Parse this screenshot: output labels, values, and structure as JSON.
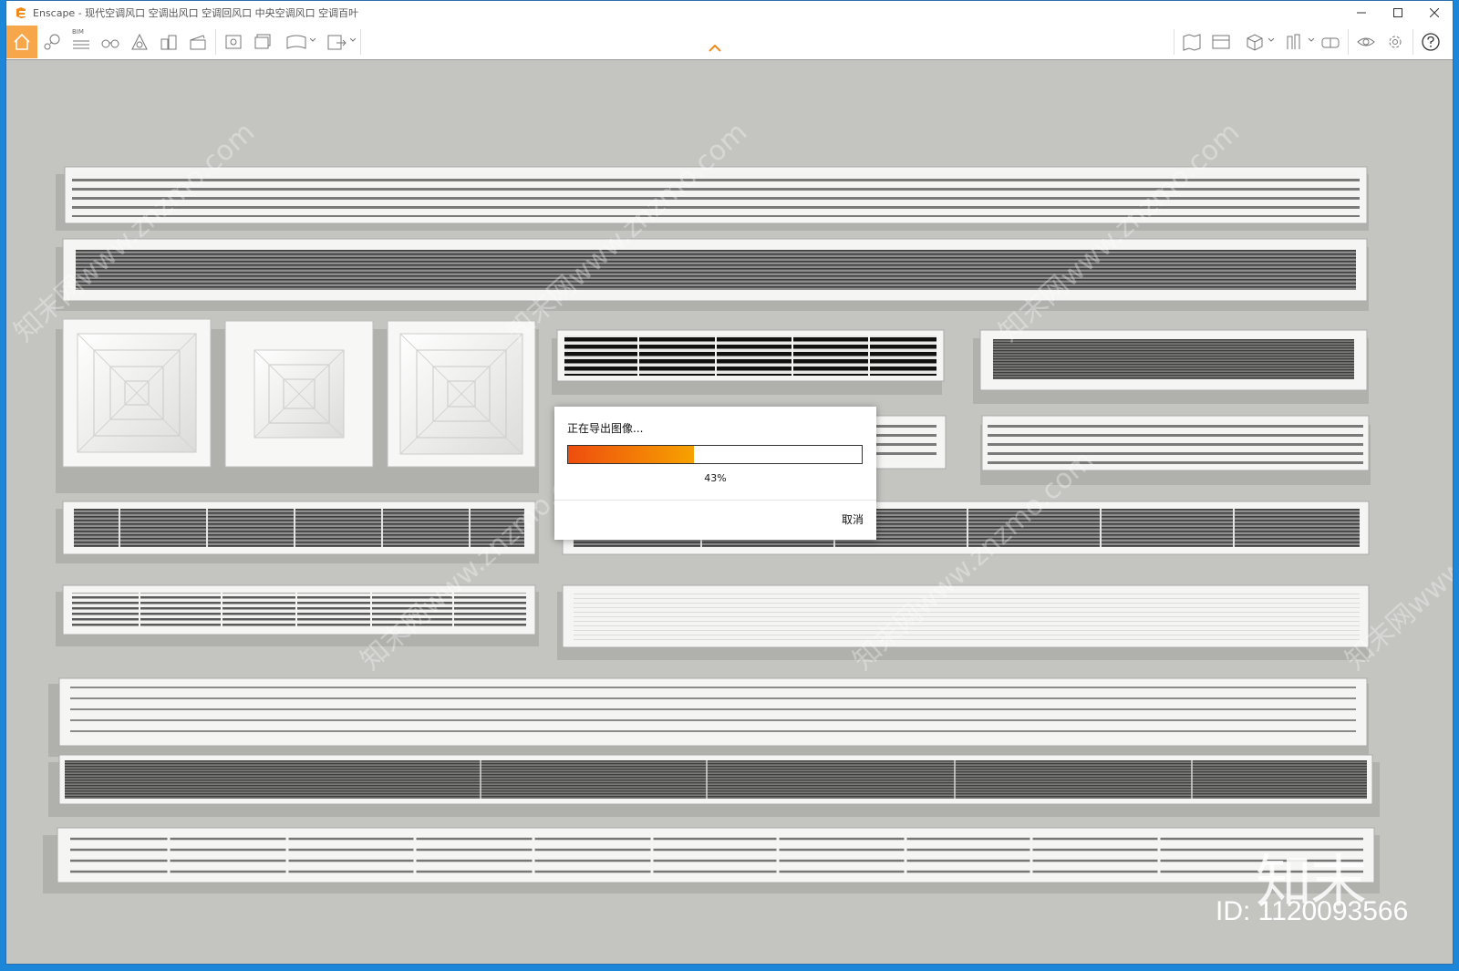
{
  "window": {
    "app_name": "Enscape",
    "title": "Enscape - 现代空调风口 空调出风口 空调回风口 中央空调风口 空调百叶"
  },
  "toolbar": {
    "bim_label": "BIM",
    "left_tools": [
      "home-icon",
      "waypoint-icon",
      "bim-list-icon",
      "binoculars-icon",
      "atmosphere-icon",
      "buildings-icon",
      "clapper-icon",
      "screenshot-icon",
      "batch-render-icon",
      "panorama-icon",
      "export-exe-icon"
    ],
    "right_tools": [
      "map-icon",
      "asset-library-icon",
      "cube-view-icon",
      "material-icon",
      "vr-headset-icon",
      "eye-icon",
      "settings-icon",
      "help-icon"
    ]
  },
  "dialog": {
    "title": "正在导出图像...",
    "progress": 0.43,
    "percent_label": "43%",
    "cancel_label": "取消"
  },
  "watermark": {
    "diagonal_text": "知末网www.znzmo.com",
    "brand": "知末",
    "id_label": "ID: 1120093566"
  },
  "colors": {
    "accent": "#f7a64a",
    "progress_start": "#ee4d0e",
    "progress_end": "#f7a200",
    "viewport_bg": "#c4c4c1"
  }
}
